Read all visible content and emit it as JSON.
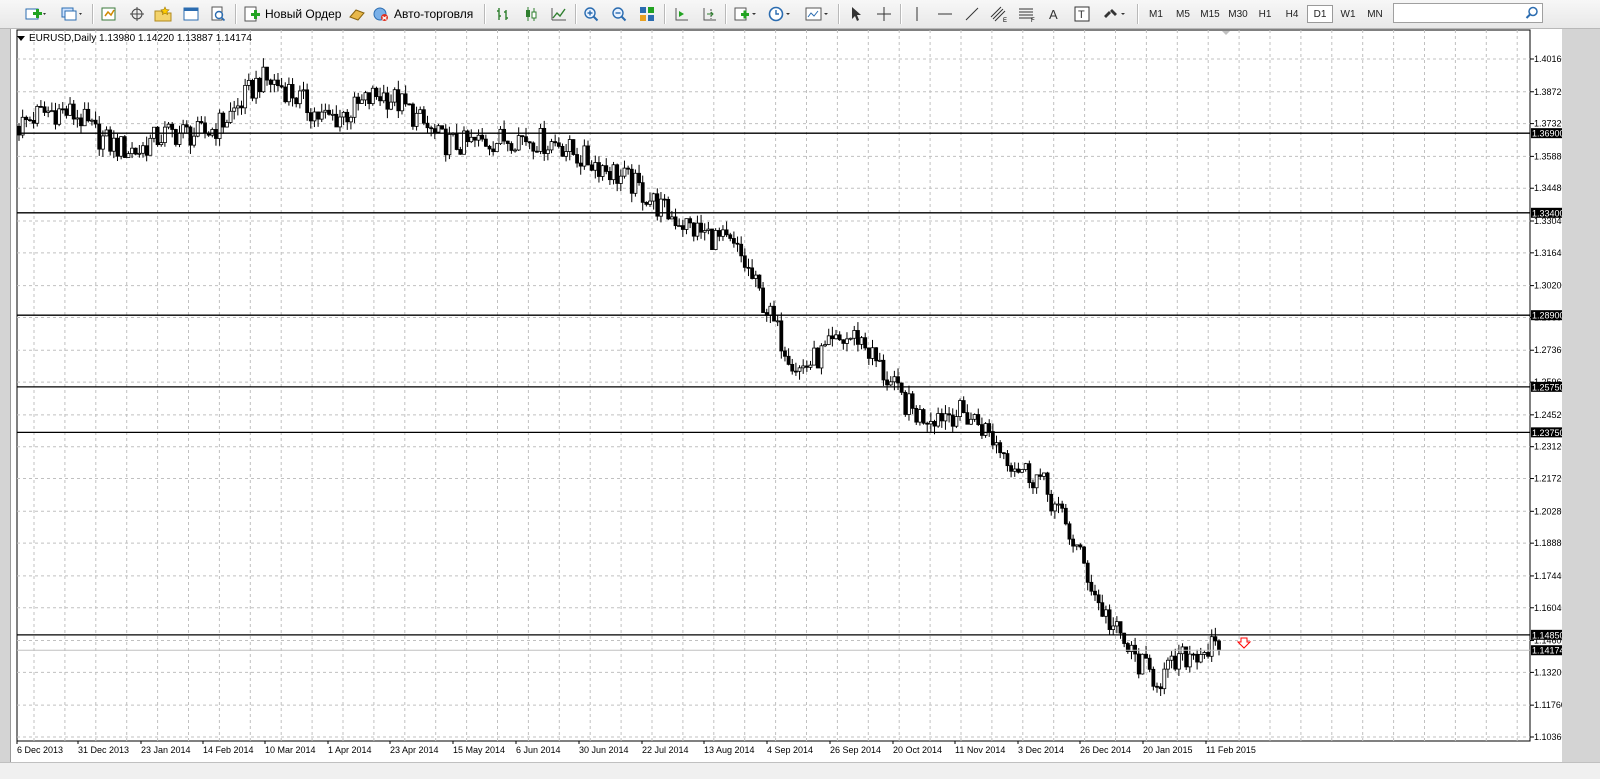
{
  "toolbar": {
    "new_order_label": "Новый Ордер",
    "autotrading_label": "Авто-торговля",
    "timeframes": [
      "M1",
      "M5",
      "M15",
      "M30",
      "H1",
      "H4",
      "D1",
      "W1",
      "MN"
    ],
    "active_timeframe": "D1"
  },
  "chart": {
    "symbol_info": "EURUSD,Daily  1.13980 1.14220 1.13887 1.14174",
    "price_scale": [
      "1.40160",
      "1.38720",
      "1.37320",
      "1.35880",
      "1.34480",
      "1.33040",
      "1.31640",
      "1.30200",
      "1.28800",
      "1.27360",
      "1.25960",
      "1.24520",
      "1.23120",
      "1.21720",
      "1.20280",
      "1.18880",
      "1.17440",
      "1.16040",
      "1.14600",
      "1.13200",
      "1.11760",
      "1.10360"
    ],
    "horizontal_lines": [
      {
        "label": "1.36900",
        "price": 1.369
      },
      {
        "label": "1.33400",
        "price": 1.334
      },
      {
        "label": "1.28900",
        "price": 1.289
      },
      {
        "label": "1.25750",
        "price": 1.2575
      },
      {
        "label": "1.23750",
        "price": 1.2375
      },
      {
        "label": "1.14850",
        "price": 1.1485
      }
    ],
    "current_price_label": "1.14174",
    "current_price": 1.14174,
    "date_labels": [
      "6 Dec 2013",
      "31 Dec 2013",
      "23 Jan 2014",
      "14 Feb 2014",
      "10 Mar 2014",
      "1 Apr 2014",
      "23 Apr 2014",
      "15 May 2014",
      "6 Jun 2014",
      "30 Jun 2014",
      "22 Jul 2014",
      "13 Aug 2014",
      "4 Sep 2014",
      "26 Sep 2014",
      "20 Oct 2014",
      "11 Nov 2014",
      "3 Dec 2014",
      "26 Dec 2014",
      "20 Jan 2015",
      "11 Feb 2015"
    ],
    "colors": {
      "background": "#ffffff",
      "grid": "#c0c0c0",
      "candle": "#000000",
      "sell_arrow": "#ff0000"
    }
  },
  "chart_data": {
    "type": "candlestick",
    "approx_close_path": [
      {
        "date": "6 Dec 2013",
        "close": 1.372
      },
      {
        "date": "31 Dec 2013",
        "close": 1.377
      },
      {
        "date": "23 Jan 2014",
        "close": 1.36
      },
      {
        "date": "14 Feb 2014",
        "close": 1.37
      },
      {
        "date": "10 Mar 2014",
        "close": 1.39
      },
      {
        "date": "1 Apr 2014",
        "close": 1.379
      },
      {
        "date": "23 Apr 2014",
        "close": 1.383
      },
      {
        "date": "15 May 2014",
        "close": 1.37
      },
      {
        "date": "6 Jun 2014",
        "close": 1.362
      },
      {
        "date": "30 Jun 2014",
        "close": 1.369
      },
      {
        "date": "22 Jul 2014",
        "close": 1.346
      },
      {
        "date": "13 Aug 2014",
        "close": 1.335
      },
      {
        "date": "4 Sep 2014",
        "close": 1.312
      },
      {
        "date": "26 Sep 2014",
        "close": 1.269
      },
      {
        "date": "20 Oct 2014",
        "close": 1.276
      },
      {
        "date": "11 Nov 2014",
        "close": 1.248
      },
      {
        "date": "3 Dec 2014",
        "close": 1.239
      },
      {
        "date": "26 Dec 2014",
        "close": 1.22
      },
      {
        "date": "20 Jan 2015",
        "close": 1.16
      },
      {
        "date": "11 Feb 2015",
        "close": 1.13
      },
      {
        "date": "20 Feb 2015",
        "close": 1.14174
      }
    ],
    "ylim": [
      1.1036,
      1.41
    ]
  }
}
